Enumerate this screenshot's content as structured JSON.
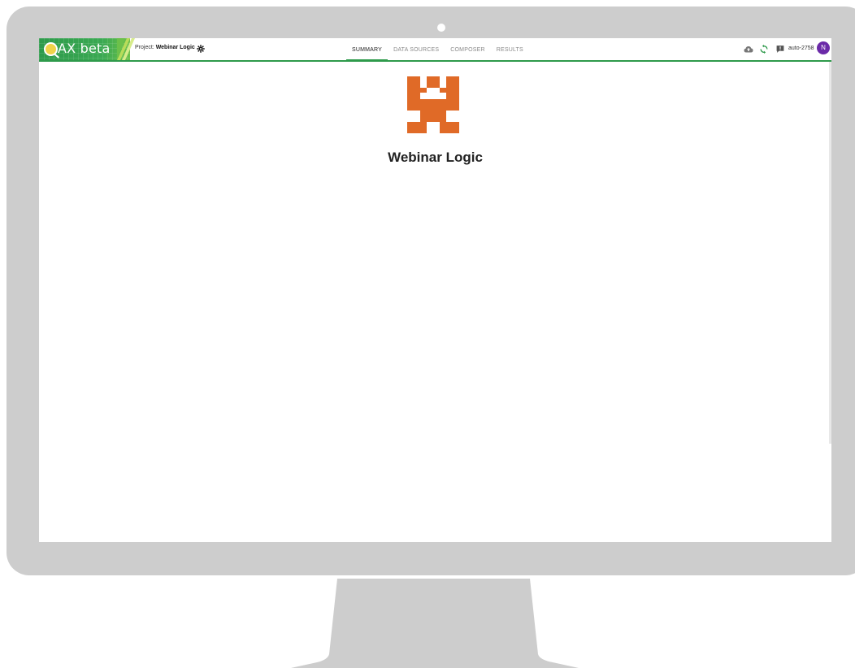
{
  "app": {
    "logo_text": "AX beta",
    "project_prefix": "Project:",
    "project_name": "Webinar Logic"
  },
  "nav": {
    "tabs": [
      {
        "label": "SUMMARY",
        "active": true
      },
      {
        "label": "DATA SOURCES",
        "active": false
      },
      {
        "label": "COMPOSER",
        "active": false
      },
      {
        "label": "RESULTS",
        "active": false
      }
    ]
  },
  "toolbar": {
    "icons": [
      "cloud-icon",
      "refresh-icon",
      "feedback-icon"
    ],
    "user_label": "auto-2758",
    "avatar_initial": "N"
  },
  "summary": {
    "title": "Webinar Logic"
  },
  "colors": {
    "accent": "#2e9a4b",
    "logo_orange": "#e06a27",
    "avatar": "#6b2aa8",
    "monitor": "#cdcdcd"
  }
}
